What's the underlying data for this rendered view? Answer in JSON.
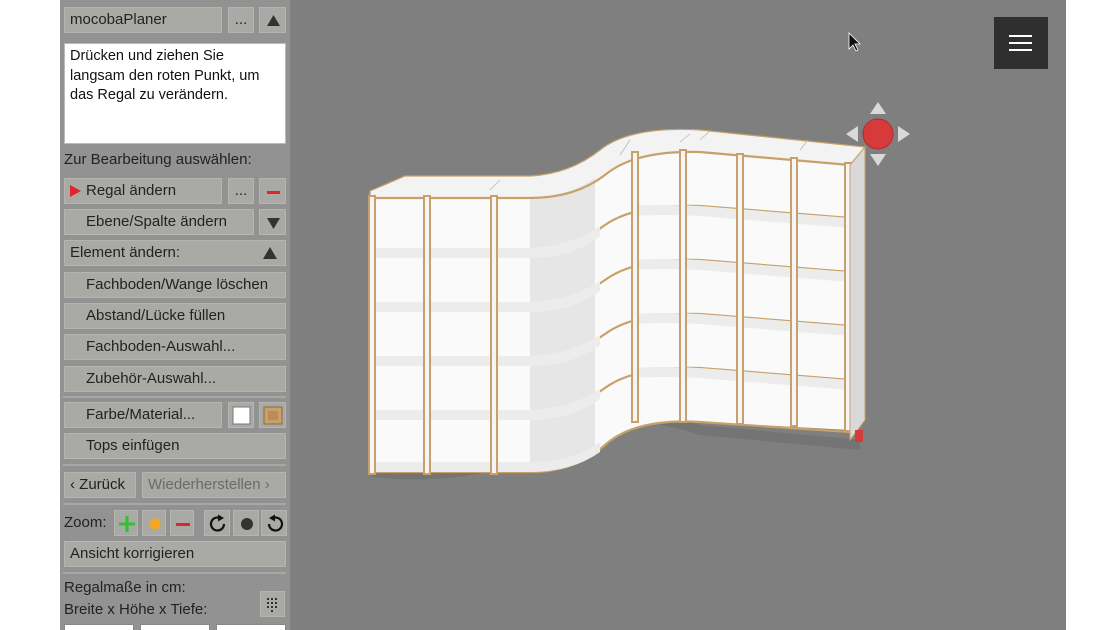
{
  "sidebar": {
    "title_label": "mocobaPlaner",
    "title_more": "...",
    "collapse_icon": "triangle-up-icon",
    "instruction": "Drücken und ziehen Sie langsam den roten Punkt, um das Regal zu verändern.",
    "select_heading": "Zur Bearbeitung auswählen:",
    "regal_label": "Regal ändern",
    "regal_more": "...",
    "ebene_label": "Ebene/Spalte ändern",
    "element_heading": "Element ändern:",
    "element_items": [
      "Fachboden/Wange löschen",
      "Abstand/Lücke füllen",
      "Fachboden-Auswahl...",
      "Zubehör-Auswahl..."
    ],
    "farbe_label": "Farbe/Material...",
    "tops_label": "Tops einfügen",
    "back_label": "‹ Zurück",
    "redo_label": "Wiederherstellen ›",
    "zoom_label": "Zoom:",
    "ansicht_label": "Ansicht korrigieren",
    "masse_label": "Regalmaße in cm:",
    "dims_label": "Breite x Höhe x Tiefe:"
  },
  "colors": {
    "app_bg": "#7f7f7f",
    "sidebar_bg": "#929292",
    "button_bg": "#a9aaa5",
    "accent_red": "#e0262b",
    "zoom_plus": "#2fc12f",
    "zoom_dot": "#f5a623",
    "handle_red": "#d63a3a",
    "material_wood": "#c8a06a"
  },
  "icons": {
    "triangle_up": "triangle-up-icon",
    "triangle_down": "triangle-down-icon",
    "play_marker": "triangle-right-icon",
    "minus": "minus-icon",
    "plus": "plus-icon",
    "rotate_cw": "rotate-clockwise-icon",
    "rotate_ccw": "rotate-counterclockwise-icon",
    "menu": "hamburger-menu-icon",
    "keypad": "keypad-icon",
    "cursor": "mouse-pointer-icon"
  }
}
